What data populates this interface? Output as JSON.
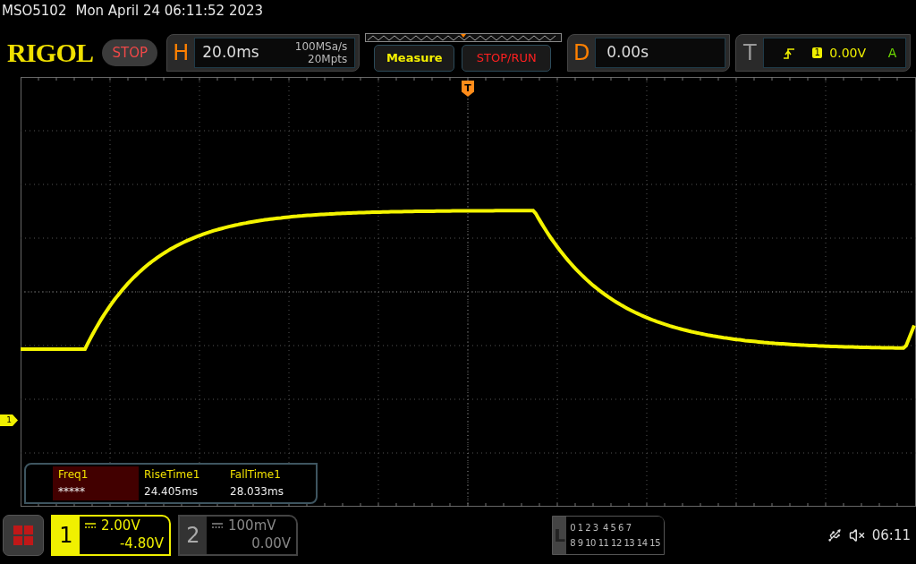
{
  "title_bar": {
    "model": "MSO5102",
    "datetime": "Mon April 24 06:11:52 2023"
  },
  "logo": "RIGOL",
  "run_state": "STOP",
  "horizontal": {
    "label": "H",
    "timebase": "20.0ms",
    "sample_rate": "100MSa/s",
    "memory_depth": "20Mpts"
  },
  "buttons": [
    {
      "label": "Measure",
      "kind": "menu"
    },
    {
      "label": "STOP/RUN",
      "kind": "run"
    }
  ],
  "delay": {
    "label": "D",
    "value": "0.00s"
  },
  "trigger": {
    "label": "T",
    "source": "1",
    "level": "0.00V",
    "mode": "A",
    "marker": "T"
  },
  "channel_marker": "1",
  "measurements": [
    {
      "label": "Freq1",
      "value": "*****",
      "selected": true
    },
    {
      "label": "RiseTime1",
      "value": "24.405ms",
      "selected": false
    },
    {
      "label": "FallTime1",
      "value": "28.033ms",
      "selected": false
    }
  ],
  "channels": [
    {
      "number": "1",
      "scale": "2.00V",
      "offset": "-4.80V",
      "selected": true
    },
    {
      "number": "2",
      "scale": "100mV",
      "offset": "0.00V",
      "selected": false
    }
  ],
  "logic": {
    "label": "L",
    "rows": [
      "0 1 2 3  4 5 6 7",
      "8 9 10 11 12 13 14 15"
    ]
  },
  "status": {
    "time": "06:11"
  }
}
